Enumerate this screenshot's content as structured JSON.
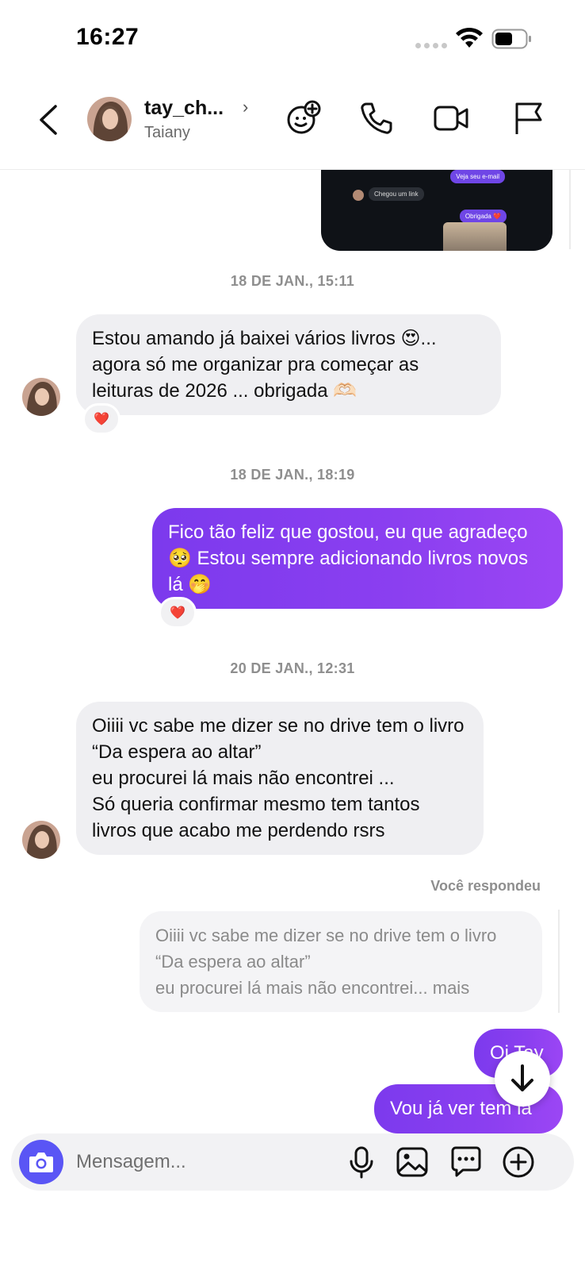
{
  "status_bar": {
    "time": "16:27"
  },
  "header": {
    "username": "tay_ch...",
    "display_name": "Taiany",
    "chevron": "›"
  },
  "preview": {
    "email_text": "Veja seu e-mail",
    "link_text": "Chegou um link",
    "thanks_text": "Obrigada ❤️"
  },
  "messages": {
    "ts1": "18 DE JAN., 15:11",
    "msg1": "Estou amando já baixei vários livros 😍... agora só me organizar pra começar as leituras de 2026 ... obrigada 🫶🏻",
    "msg1_reaction": "❤️",
    "ts2": "18 DE JAN., 18:19",
    "msg2": "Fico tão feliz que gostou, eu que agradeço🥺 Estou sempre adicionando livros novos lá 🤭",
    "msg2_reaction": "❤️",
    "ts3": "20 DE JAN., 12:31",
    "msg3_line1": "Oiiii vc sabe me dizer se no drive tem o livro “Da espera ao altar”",
    "msg3_line2": "eu procurei lá mais não encontrei ...",
    "msg3_line3": "Só queria confirmar mesmo tem tantos livros que acabo me perdendo rsrs",
    "replied_label": "Você respondeu",
    "quote_line1": "Oiiii vc sabe me dizer se no drive tem o livro “Da espera ao altar”",
    "quote_line2": "eu procurei lá mais não encontrei... mais",
    "msg4": "Oi Tay",
    "msg5": "Vou já ver tem lá"
  },
  "composer": {
    "placeholder": "Mensagem..."
  },
  "colors": {
    "accent_purple": "#8b3ff0",
    "camera_blue": "#5a55f5",
    "incoming_bubble": "#efeff2",
    "timestamp_gray": "#8e8e8e"
  },
  "icons": {
    "back": "chevron-left-icon",
    "effects": "face-plus-icon",
    "call": "phone-icon",
    "video": "video-camera-icon",
    "report": "flag-icon",
    "scroll": "arrow-down-icon",
    "camera": "camera-icon",
    "mic": "microphone-icon",
    "gallery": "image-icon",
    "sticker": "sticker-icon",
    "more": "plus-circle-icon"
  }
}
